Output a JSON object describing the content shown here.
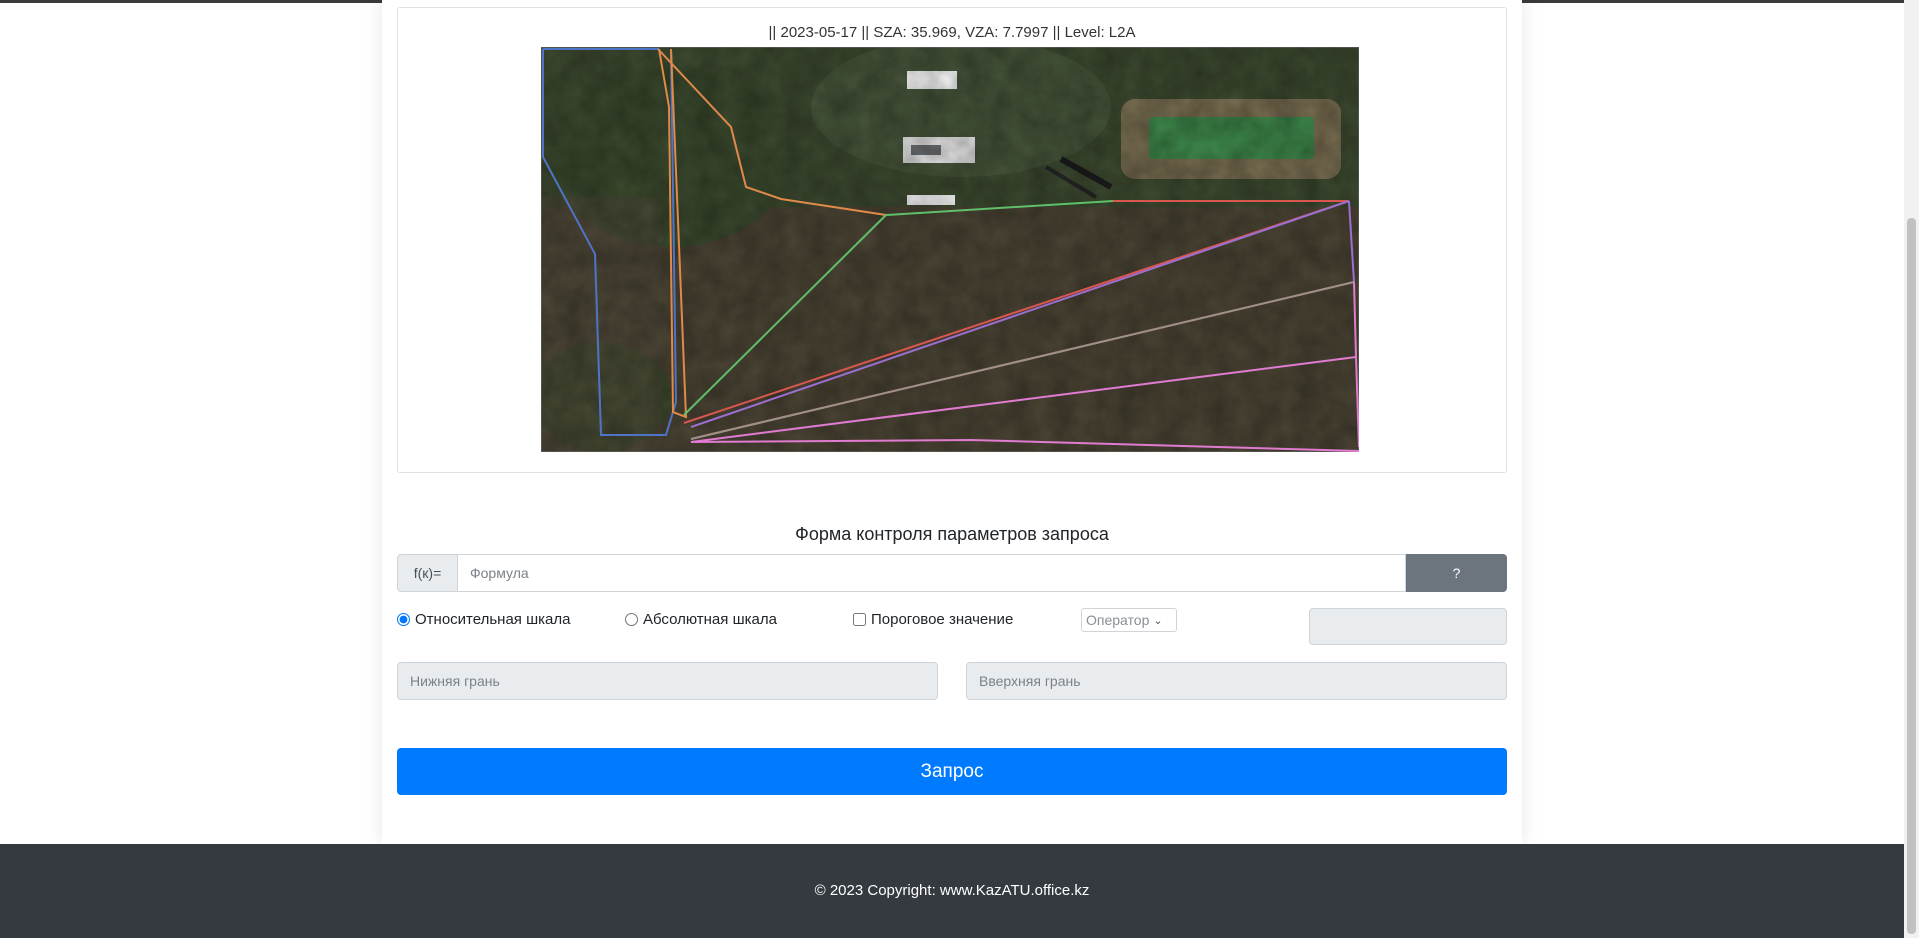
{
  "image_card": {
    "title": "|| 2023-05-17 || SZA: 35.969, VZA: 7.7997 || Level: L2A"
  },
  "form": {
    "title": "Форма контроля параметров запроса",
    "formula_prefix": "f(к)=",
    "formula_placeholder": "Формула",
    "help_label": "?",
    "relative_scale_label": "Относительная шкала",
    "absolute_scale_label": "Абсолютная шкала",
    "threshold_label": "Пороговое значение",
    "operator_placeholder": "Оператор",
    "lower_bound_placeholder": "Нижняя грань",
    "upper_bound_placeholder": "Вверхняя грань",
    "submit_label": "Запрос"
  },
  "footer": {
    "copyright": "© 2023 Copyright: www.KazATU.office.kz"
  },
  "colors": {
    "primary": "#007bff",
    "secondary": "#6c757d",
    "footer_bg": "#343a40"
  }
}
